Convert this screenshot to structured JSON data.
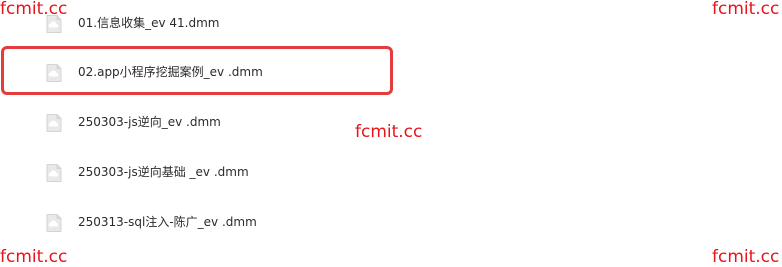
{
  "files": [
    {
      "name": "01.信息收集_ev 41.dmm",
      "icon": "cloud-file-icon"
    },
    {
      "name": "02.app小程序挖掘案例_ev .dmm",
      "icon": "cloud-file-icon"
    },
    {
      "name": "250303-js逆向_ev .dmm",
      "icon": "cloud-file-icon"
    },
    {
      "name": "250303-js逆向基础 _ev .dmm",
      "icon": "cloud-file-icon"
    },
    {
      "name": "250313-sql注入-陈广_ev .dmm",
      "icon": "cloud-file-icon"
    }
  ],
  "highlighted_index": 1,
  "highlight_color": "#e53b3b",
  "watermarks": {
    "top_left": "fcmit.cc",
    "top_right": "fcmit.cc",
    "center": "fcmit.cc",
    "bottom_left": "fcmit.cc",
    "bottom_right": "fcmit.cc"
  },
  "watermark_color": "#e8141c"
}
